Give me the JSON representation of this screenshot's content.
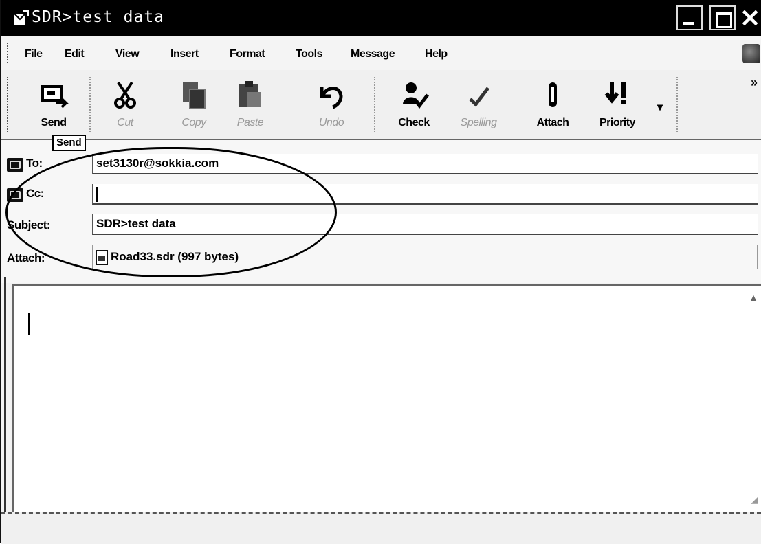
{
  "window": {
    "title": "SDR>test data"
  },
  "menu": [
    {
      "label": "File"
    },
    {
      "label": "Edit"
    },
    {
      "label": "View"
    },
    {
      "label": "Insert"
    },
    {
      "label": "Format"
    },
    {
      "label": "Tools"
    },
    {
      "label": "Message"
    },
    {
      "label": "Help"
    }
  ],
  "toolbar": {
    "send": "Send",
    "cut": "Cut",
    "copy": "Copy",
    "paste": "Paste",
    "undo": "Undo",
    "check": "Check",
    "spelling": "Spelling",
    "attach": "Attach",
    "priority": "Priority"
  },
  "tooltip": "Send",
  "fields": {
    "to_label": "To:",
    "to_value": "set3130r@sokkia.com",
    "cc_label": "Cc:",
    "cc_value": "",
    "subject_label": "Subject:",
    "subject_value": "SDR>test data",
    "attach_label": "Attach:",
    "attach_value": "Road33.sdr (997 bytes)"
  },
  "icons": {
    "send": "send-icon",
    "cut": "scissors-icon",
    "copy": "copy-icon",
    "paste": "paste-icon",
    "undo": "undo-icon",
    "check": "check-names-icon",
    "spelling": "spelling-icon",
    "attach": "paperclip-icon",
    "priority": "priority-icon"
  }
}
